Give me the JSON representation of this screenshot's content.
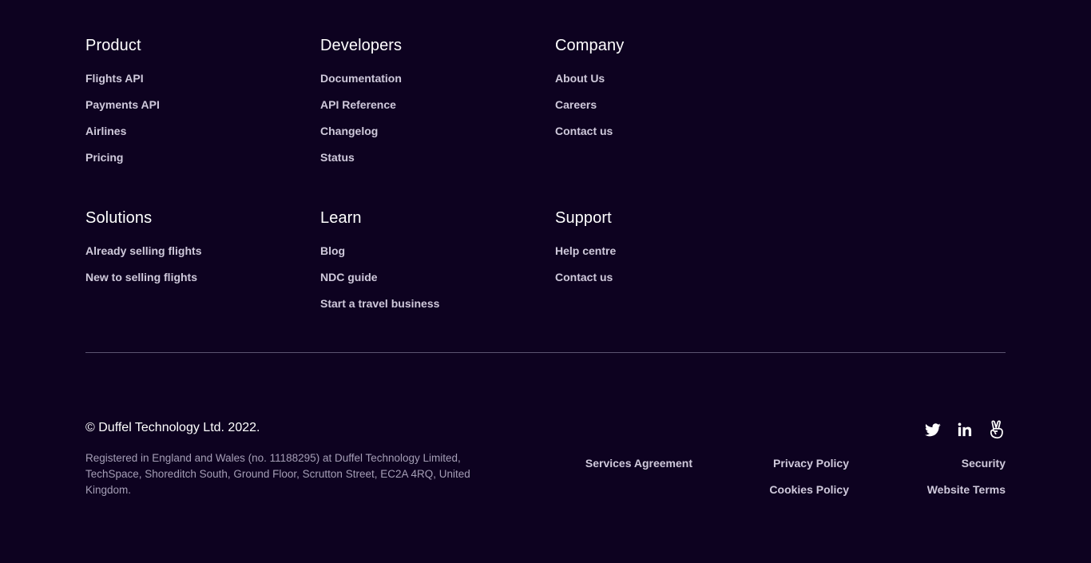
{
  "columns": [
    {
      "heading": "Product",
      "links": [
        "Flights API",
        "Payments API",
        "Airlines",
        "Pricing"
      ]
    },
    {
      "heading": "Developers",
      "links": [
        "Documentation",
        "API Reference",
        "Changelog",
        "Status"
      ]
    },
    {
      "heading": "Company",
      "links": [
        "About Us",
        "Careers",
        "Contact us"
      ]
    },
    {
      "heading": "Solutions",
      "links": [
        "Already selling flights",
        "New to selling flights"
      ]
    },
    {
      "heading": "Learn",
      "links": [
        "Blog",
        "NDC guide",
        "Start a travel business"
      ]
    },
    {
      "heading": "Support",
      "links": [
        "Help centre",
        "Contact us"
      ]
    }
  ],
  "bottom": {
    "copyright": "© Duffel Technology Ltd. 2022.",
    "registered": "Registered in England and Wales (no. 11188295) at Duffel Technology Limited, TechSpace, Shoreditch South, Ground Floor, Scrutton Street, EC2A 4RQ, United Kingdom.",
    "social": [
      {
        "icon": "twitter-icon"
      },
      {
        "icon": "linkedin-icon"
      },
      {
        "icon": "angellist-icon"
      }
    ],
    "legal_links": {
      "services_agreement": "Services Agreement",
      "privacy_policy": "Privacy Policy",
      "security": "Security",
      "cookies_policy": "Cookies Policy",
      "website_terms": "Website Terms"
    }
  },
  "colors": {
    "background": "#0d0220",
    "heading": "#ffffff",
    "link": "#cfc9db",
    "muted": "#a59eb6",
    "divider": "#5b5470"
  }
}
